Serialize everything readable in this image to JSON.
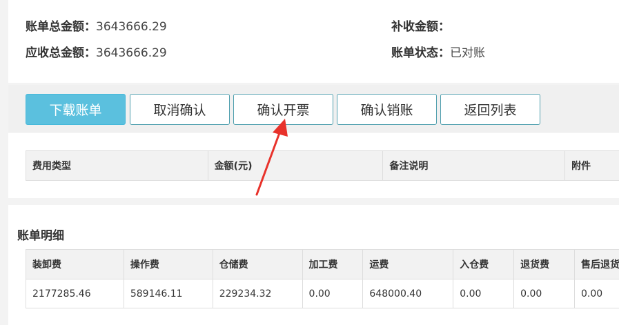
{
  "summary": {
    "bill_total_label": "账单总金额：",
    "bill_total_value": "3643666.29",
    "receivable_total_label": "应收总金额：",
    "receivable_total_value": "3643666.29",
    "supplement_label": "补收金额：",
    "supplement_value": "",
    "status_label": "账单状态：",
    "status_value": "已对账"
  },
  "toolbar": {
    "download_label": "下载账单",
    "cancel_confirm_label": "取消确认",
    "confirm_invoice_label": "确认开票",
    "confirm_writeoff_label": "确认销账",
    "back_to_list_label": "返回列表"
  },
  "fee_table": {
    "headers": [
      "费用类型",
      "金额(元)",
      "备注说明",
      "附件"
    ]
  },
  "detail": {
    "title": "账单明细",
    "headers": [
      "装卸费",
      "操作费",
      "仓储费",
      "加工费",
      "运费",
      "入仓费",
      "退货费",
      "售后退货"
    ],
    "row": [
      "2177285.46",
      "589146.11",
      "229234.32",
      "0.00",
      "648000.40",
      "0.00",
      "0.00",
      "0.00"
    ]
  },
  "colors": {
    "primary_button": "#5bc0de",
    "annotation_arrow": "#e8322b"
  }
}
